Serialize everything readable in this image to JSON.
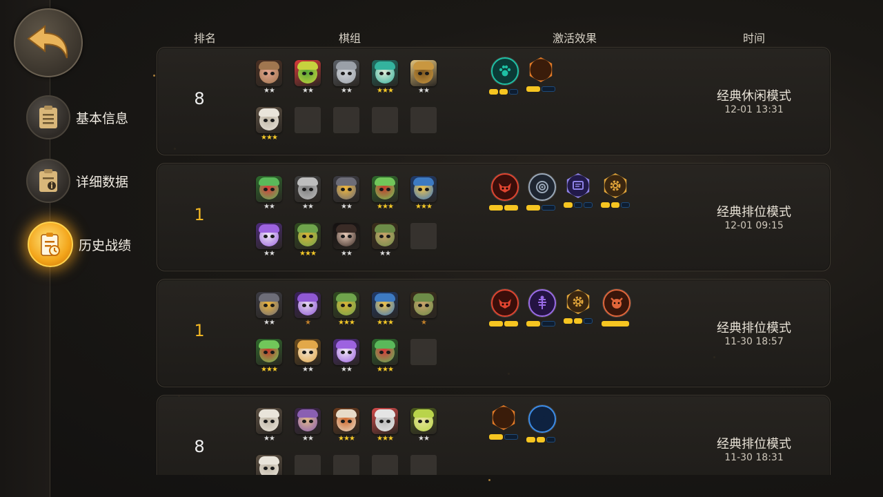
{
  "nav": {
    "back": "back-arrow-icon",
    "items": [
      {
        "label": "基本信息",
        "icon": "clipboard-icon",
        "active": false
      },
      {
        "label": "详细数据",
        "icon": "info-clipboard-icon",
        "active": false
      },
      {
        "label": "历史战绩",
        "icon": "history-clipboard-icon",
        "active": true
      }
    ]
  },
  "headers": {
    "rank": "排名",
    "lineup": "棋组",
    "effects": "激活效果",
    "time": "时间"
  },
  "matches": [
    {
      "rank": "8",
      "result": "lose",
      "champions": [
        {
          "icon": "pig-hero-icon",
          "stars": 2,
          "colors": [
            "#a0764f",
            "#e2a38d",
            "#4a2f22"
          ]
        },
        {
          "icon": "goblin-green-icon",
          "stars": 2,
          "colors": [
            "#c7d23e",
            "#59a636",
            "#d83a3a"
          ]
        },
        {
          "icon": "grey-beast-icon",
          "stars": 2,
          "colors": [
            "#9aa0a8",
            "#cfd3d7",
            "#5a5f66"
          ]
        },
        {
          "icon": "teal-elf-icon",
          "stars": 3,
          "colors": [
            "#34b39e",
            "#dfe9d5",
            "#1f6d62"
          ]
        },
        {
          "icon": "golden-warrior-icon",
          "stars": 2,
          "colors": [
            "#c99740",
            "#7d5720",
            "#e2c37c"
          ]
        },
        {
          "icon": "white-beard-icon",
          "stars": 3,
          "colors": [
            "#e9e4da",
            "#bfb6a6",
            "#5b4f42"
          ]
        }
      ],
      "empty_slots": 4,
      "synergies": [
        {
          "icon": "paw-icon",
          "shape": "circle",
          "color": "#1ec0a4",
          "bg": "#0b3a36",
          "segments": 3,
          "active": 2
        },
        {
          "icon": "leaf-icon",
          "shape": "hex",
          "color": "#e27a26",
          "bg": "#3a1c0a",
          "segments": 2,
          "active": 1
        }
      ],
      "mode": "经典休闲模式",
      "time": "12-01 13:31"
    },
    {
      "rank": "1",
      "result": "win",
      "champions": [
        {
          "icon": "masked-bandit-icon",
          "stars": 2,
          "colors": [
            "#5ab95a",
            "#d83a3a",
            "#2c6a2c"
          ]
        },
        {
          "icon": "stone-golem-icon",
          "stars": 2,
          "colors": [
            "#bdbdbd",
            "#7e7e7e",
            "#3e3e3e"
          ]
        },
        {
          "icon": "robot-head-icon",
          "stars": 2,
          "colors": [
            "#6d6d78",
            "#f0b63a",
            "#3b3b43"
          ]
        },
        {
          "icon": "goblin-red-cap-icon",
          "stars": 3,
          "colors": [
            "#71c65a",
            "#c43b2c",
            "#2f6a2c"
          ]
        },
        {
          "icon": "helmet-robot-icon",
          "stars": 3,
          "colors": [
            "#3d7ac2",
            "#f0c24a",
            "#1f3a6a"
          ]
        },
        {
          "icon": "purple-hair-icon",
          "stars": 2,
          "colors": [
            "#9d63e0",
            "#efe7f5",
            "#4c2b7a"
          ]
        },
        {
          "icon": "goblin-armor-icon",
          "stars": 3,
          "colors": [
            "#6fa44c",
            "#d7b237",
            "#2f4a1f"
          ]
        },
        {
          "icon": "dark-hair-icon",
          "stars": 2,
          "colors": [
            "#3a2b26",
            "#e6c9b7",
            "#141010"
          ]
        },
        {
          "icon": "bald-goblin-icon",
          "stars": 2,
          "colors": [
            "#6d8c48",
            "#c9a26a",
            "#3a2d1a"
          ]
        }
      ],
      "empty_slots": 1,
      "synergies": [
        {
          "icon": "demon-icon",
          "shape": "circle",
          "color": "#e0442f",
          "bg": "#3a0e0a",
          "segments": 2,
          "active": 2
        },
        {
          "icon": "spiral-icon",
          "shape": "circle",
          "color": "#9aa8b8",
          "bg": "#1e2530",
          "segments": 2,
          "active": 1
        },
        {
          "icon": "card-icon",
          "shape": "hex",
          "color": "#8f83e8",
          "bg": "#221a4a",
          "segments": 3,
          "active": 1
        },
        {
          "icon": "gear-icon",
          "shape": "hex",
          "color": "#e0a43a",
          "bg": "#3a2610",
          "segments": 3,
          "active": 2
        }
      ],
      "mode": "经典排位模式",
      "time": "12-01 09:15"
    },
    {
      "rank": "1",
      "result": "win",
      "champions": [
        {
          "icon": "robot-head-icon",
          "stars": 2,
          "colors": [
            "#6d6d78",
            "#f0b63a",
            "#3b3b43"
          ]
        },
        {
          "icon": "purple-goblin-icon",
          "stars": 1,
          "colors": [
            "#8f58d4",
            "#e5d8ef",
            "#3a1f5c"
          ]
        },
        {
          "icon": "goblin-armor-icon",
          "stars": 3,
          "colors": [
            "#6fa44c",
            "#d7b237",
            "#2f4a1f"
          ]
        },
        {
          "icon": "helmet-robot-icon",
          "stars": 3,
          "colors": [
            "#3d7ac2",
            "#f0c24a",
            "#1f3a6a"
          ]
        },
        {
          "icon": "bald-goblin-icon",
          "stars": 1,
          "colors": [
            "#6d8c48",
            "#c9a26a",
            "#3a2d1a"
          ]
        },
        {
          "icon": "goblin-red-cap-icon",
          "stars": 3,
          "colors": [
            "#71c65a",
            "#c43b2c",
            "#2f6a2c"
          ]
        },
        {
          "icon": "monkey-icon",
          "stars": 2,
          "colors": [
            "#e2a84a",
            "#f0e3d0",
            "#6a4a1c"
          ]
        },
        {
          "icon": "purple-hair-icon",
          "stars": 2,
          "colors": [
            "#9d63e0",
            "#efe7f5",
            "#4c2b7a"
          ]
        },
        {
          "icon": "masked-bandit-icon",
          "stars": 3,
          "colors": [
            "#5ab95a",
            "#d83a3a",
            "#2c6a2c"
          ]
        }
      ],
      "empty_slots": 1,
      "synergies": [
        {
          "icon": "demon-icon",
          "shape": "circle",
          "color": "#e0442f",
          "bg": "#3a0e0a",
          "segments": 2,
          "active": 2
        },
        {
          "icon": "fish-bone-icon",
          "shape": "circle",
          "color": "#9a6be8",
          "bg": "#241342",
          "segments": 2,
          "active": 1
        },
        {
          "icon": "gear-icon",
          "shape": "hex",
          "color": "#e0a43a",
          "bg": "#3a2610",
          "segments": 3,
          "active": 2
        },
        {
          "icon": "ogre-icon",
          "shape": "circle",
          "color": "#e0653a",
          "bg": "#3a160a",
          "segments": 1,
          "active": 1
        }
      ],
      "mode": "经典排位模式",
      "time": "11-30 18:57"
    },
    {
      "rank": "8",
      "result": "lose",
      "champions": [
        {
          "icon": "white-beard-icon",
          "stars": 2,
          "colors": [
            "#e9e4da",
            "#bfb6a6",
            "#5b4f42"
          ]
        },
        {
          "icon": "hooded-mage-icon",
          "stars": 2,
          "colors": [
            "#8a5fb2",
            "#e1b88a",
            "#3a2448"
          ]
        },
        {
          "icon": "tiger-warrior-icon",
          "stars": 3,
          "colors": [
            "#e7dbc8",
            "#d06a2e",
            "#6a3a1c"
          ]
        },
        {
          "icon": "white-beast-icon",
          "stars": 3,
          "colors": [
            "#e5e5e5",
            "#b9b9b9",
            "#d44a4a"
          ]
        },
        {
          "icon": "frog-icon",
          "stars": 2,
          "colors": [
            "#b9d44a",
            "#e6e39a",
            "#4a5a1c"
          ]
        },
        {
          "icon": "white-beard-icon",
          "stars": 0,
          "colors": [
            "#e9e4da",
            "#bfb6a6",
            "#5b4f42"
          ]
        }
      ],
      "empty_slots": 4,
      "synergies": [
        {
          "icon": "leaf-icon",
          "shape": "hex",
          "color": "#e27a26",
          "bg": "#3a1c0a",
          "segments": 2,
          "active": 1
        },
        {
          "icon": "feather-icon",
          "shape": "circle",
          "color": "#3a8ce8",
          "bg": "#0e2240",
          "segments": 3,
          "active": 2
        }
      ],
      "mode": "经典排位模式",
      "time": "11-30 18:31"
    }
  ]
}
